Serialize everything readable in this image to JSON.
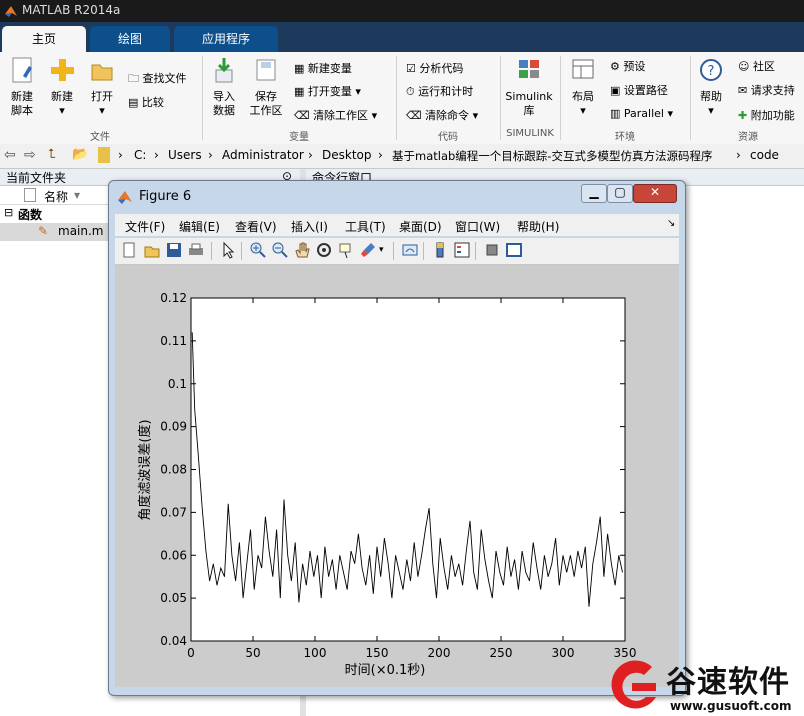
{
  "app": {
    "title": "MATLAB R2014a"
  },
  "tabs": [
    "主页",
    "绘图",
    "应用程序"
  ],
  "ribbon": {
    "file": {
      "new_script": [
        "新建",
        "脚本"
      ],
      "new": "新建",
      "open": "打开",
      "find_files": "查找文件",
      "compare": "比较",
      "group": "文件"
    },
    "variable": {
      "import": [
        "导入",
        "数据"
      ],
      "save": [
        "保存",
        "工作区"
      ],
      "new_var": "新建变量",
      "open_var": "打开变量",
      "clear_ws": "清除工作区",
      "group": "变量"
    },
    "code": {
      "analyze": "分析代码",
      "run_time": "运行和计时",
      "clear_cmd": "清除命令",
      "group": "代码"
    },
    "simulink": {
      "lib": [
        "Simulink",
        "库"
      ],
      "group": "SIMULINK"
    },
    "env": {
      "layout": "布局",
      "prefs": "预设",
      "set_path": "设置路径",
      "parallel": "Parallel",
      "group": "环境"
    },
    "resources": {
      "help": "帮助",
      "community": "社区",
      "request_support": "请求支持",
      "addons": "附加功能",
      "group": "资源"
    }
  },
  "address": {
    "crumbs": [
      "C:",
      "Users",
      "Administrator",
      "Desktop",
      "基于matlab编程一个目标跟踪-交互式多模型仿真方法源码程序",
      "code"
    ]
  },
  "left_panel": {
    "title": "当前文件夹",
    "col_name": "名称",
    "group": "函数",
    "file": "main.m"
  },
  "cmd_panel": {
    "title": "命令行窗口"
  },
  "figure": {
    "title": "Figure 6",
    "menu": [
      "文件(F)",
      "编辑(E)",
      "查看(V)",
      "插入(I)",
      "工具(T)",
      "桌面(D)",
      "窗口(W)",
      "帮助(H)"
    ]
  },
  "chart_data": {
    "type": "line",
    "title": "",
    "xlabel": "时间(×0.1秒)",
    "ylabel": "角度滤波误差(度)",
    "xlim": [
      0,
      350
    ],
    "ylim": [
      0.04,
      0.12
    ],
    "xticks": [
      0,
      50,
      100,
      150,
      200,
      250,
      300,
      350
    ],
    "yticks": [
      0.04,
      0.05,
      0.06,
      0.07,
      0.08,
      0.09,
      0.1,
      0.11,
      0.12
    ],
    "grid": false,
    "series": [
      {
        "color": "#000000",
        "x": [
          1,
          3,
          6,
          9,
          12,
          15,
          18,
          21,
          24,
          27,
          30,
          33,
          36,
          39,
          42,
          45,
          48,
          51,
          54,
          57,
          60,
          63,
          66,
          69,
          72,
          75,
          78,
          81,
          84,
          87,
          90,
          93,
          96,
          99,
          102,
          105,
          108,
          111,
          114,
          117,
          120,
          123,
          126,
          129,
          132,
          135,
          138,
          141,
          144,
          147,
          150,
          153,
          156,
          159,
          162,
          165,
          168,
          171,
          174,
          177,
          180,
          183,
          186,
          189,
          192,
          195,
          198,
          201,
          204,
          207,
          210,
          213,
          216,
          219,
          222,
          225,
          228,
          231,
          234,
          237,
          240,
          243,
          246,
          249,
          252,
          255,
          258,
          261,
          264,
          267,
          270,
          273,
          276,
          279,
          282,
          285,
          288,
          291,
          294,
          297,
          300,
          303,
          306,
          309,
          312,
          315,
          318,
          321,
          324,
          327,
          330,
          333,
          336,
          339,
          342,
          345,
          348
        ],
        "y": [
          0.112,
          0.094,
          0.083,
          0.071,
          0.061,
          0.054,
          0.058,
          0.053,
          0.057,
          0.055,
          0.072,
          0.06,
          0.054,
          0.063,
          0.05,
          0.058,
          0.066,
          0.052,
          0.06,
          0.057,
          0.069,
          0.061,
          0.055,
          0.066,
          0.05,
          0.073,
          0.06,
          0.054,
          0.063,
          0.049,
          0.058,
          0.053,
          0.061,
          0.055,
          0.06,
          0.05,
          0.062,
          0.055,
          0.059,
          0.052,
          0.06,
          0.056,
          0.052,
          0.061,
          0.058,
          0.065,
          0.057,
          0.053,
          0.06,
          0.051,
          0.062,
          0.055,
          0.064,
          0.058,
          0.05,
          0.06,
          0.056,
          0.052,
          0.059,
          0.054,
          0.063,
          0.055,
          0.06,
          0.066,
          0.071,
          0.058,
          0.05,
          0.064,
          0.057,
          0.052,
          0.06,
          0.055,
          0.058,
          0.053,
          0.061,
          0.068,
          0.056,
          0.052,
          0.066,
          0.059,
          0.054,
          0.05,
          0.061,
          0.056,
          0.053,
          0.062,
          0.055,
          0.059,
          0.052,
          0.061,
          0.056,
          0.054,
          0.063,
          0.057,
          0.052,
          0.06,
          0.055,
          0.058,
          0.064,
          0.053,
          0.06,
          0.056,
          0.06,
          0.055,
          0.061,
          0.057,
          0.062,
          0.048,
          0.058,
          0.063,
          0.069,
          0.055,
          0.065,
          0.058,
          0.053,
          0.06,
          0.056
        ]
      }
    ]
  },
  "watermark": {
    "name": "谷速软件",
    "url": "www.gusuoft.com"
  }
}
